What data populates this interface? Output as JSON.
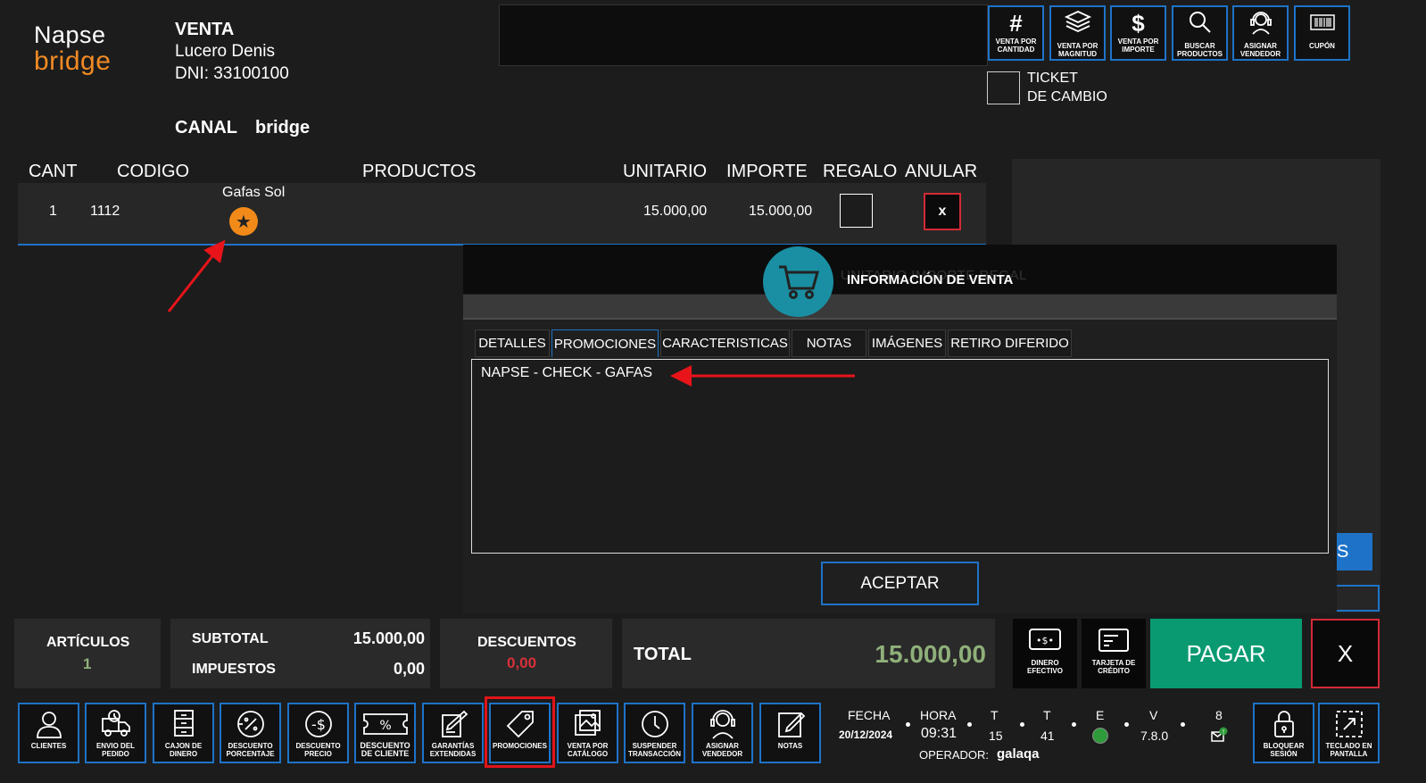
{
  "logo": {
    "line1": "Napse",
    "line2": "bridge"
  },
  "customer": {
    "type": "VENTA",
    "name": "Lucero Denis",
    "dni": "DNI: 33100100",
    "canal_label": "CANAL",
    "canal_value": "bridge"
  },
  "toolbar": [
    {
      "icon": "hash-icon",
      "glyph": "#",
      "label": "VENTA POR CANTIDAD"
    },
    {
      "icon": "layers-icon",
      "glyph": "",
      "label": "VENTA POR MAGNITUD"
    },
    {
      "icon": "dollar-icon",
      "glyph": "$",
      "label": "VENTA POR IMPORTE"
    },
    {
      "icon": "magnifier-icon",
      "glyph": "",
      "label": "BUSCAR PRODUCTOS"
    },
    {
      "icon": "headset-icon",
      "glyph": "",
      "label": "ASIGNAR VENDEDOR"
    },
    {
      "icon": "barcode-icon",
      "glyph": "",
      "label": "CUPÓN"
    }
  ],
  "ticket_cambio": {
    "line1": "TICKET",
    "line2": "DE CAMBIO"
  },
  "table": {
    "headers": {
      "cant": "CANT",
      "codigo": "CODIGO",
      "productos": "PRODUCTOS",
      "unitario": "UNITARIO",
      "importe": "IMPORTE",
      "regalo": "REGALO",
      "anular": "ANULAR"
    },
    "rows": [
      {
        "cant": "1",
        "codigo": "1112",
        "producto": "Gafas Sol",
        "unitario": "15.000,00",
        "importe": "15.000,00",
        "anular": "x"
      }
    ]
  },
  "modal": {
    "title": "INFORMACIÓN DE VENTA",
    "ghost_text": "UNITARIO   IMPORTE   REGAL",
    "tabs": [
      "DETALLES",
      "PROMOCIONES",
      "CARACTERISTICAS",
      "NOTAS",
      "IMÁGENES",
      "RETIRO DIFERIDO"
    ],
    "active_tab": "PROMOCIONES",
    "promotions": [
      "NAPSE - CHECK - GAFAS"
    ],
    "accept": "ACEPTAR",
    "peek_text": "S"
  },
  "summary": {
    "articulos_label": "ARTÍCULOS",
    "articulos_value": "1",
    "subtotal_label": "SUBTOTAL",
    "subtotal_value": "15.000,00",
    "impuestos_label": "IMPUESTOS",
    "impuestos_value": "0,00",
    "descuentos_label": "DESCUENTOS",
    "descuentos_value": "0,00",
    "total_label": "TOTAL",
    "total_value": "15.000,00",
    "dinero_label": "DINERO EFECTIVO",
    "tarjeta_label": "TARJETA DE CRÉDITO",
    "pagar": "PAGAR",
    "cancel": "X"
  },
  "bottom_buttons": [
    {
      "icon": "person-icon",
      "label": "CLIENTES"
    },
    {
      "icon": "truck-icon",
      "label": "ENVIO DEL PEDIDO"
    },
    {
      "icon": "cash-drawer-icon",
      "label": "CAJON DE DINERO"
    },
    {
      "icon": "percent-discount-icon",
      "label": "DESCUENTO PORCENTAJE"
    },
    {
      "icon": "price-discount-icon",
      "label": "DESCUENTO PRECIO"
    },
    {
      "icon": "client-discount-icon",
      "label": "DESCUENTO DE CLIENTE"
    },
    {
      "icon": "warranty-icon",
      "label": "GARANTÍAS EXTENDIDAS"
    },
    {
      "icon": "tag-icon",
      "label": "PROMOCIONES"
    },
    {
      "icon": "catalog-icon",
      "label": "VENTA POR CATÁLOGO"
    },
    {
      "icon": "clock-icon",
      "label": "SUSPENDER TRANSACCIÓN"
    },
    {
      "icon": "headset-icon",
      "label": "ASIGNAR VENDEDOR"
    },
    {
      "icon": "note-icon",
      "label": "NOTAS"
    }
  ],
  "status": {
    "fecha_label": "FECHA",
    "fecha": "20/12/2024",
    "hora_label": "HORA",
    "hora": "09:31",
    "t1_label": "T",
    "t1": "15",
    "t2_label": "T",
    "t2": "41",
    "e_label": "E",
    "v_label": "V",
    "v": "7.8.0",
    "n_label": "8",
    "operador_label": "OPERADOR:",
    "operador": "galaqa",
    "status_color": "#2e9a3a"
  },
  "right_buttons": [
    {
      "icon": "lock-icon",
      "label": "BLOQUEAR SESIÓN"
    },
    {
      "icon": "keyboard-icon",
      "label": "TECLADO EN PANTALLA"
    }
  ]
}
